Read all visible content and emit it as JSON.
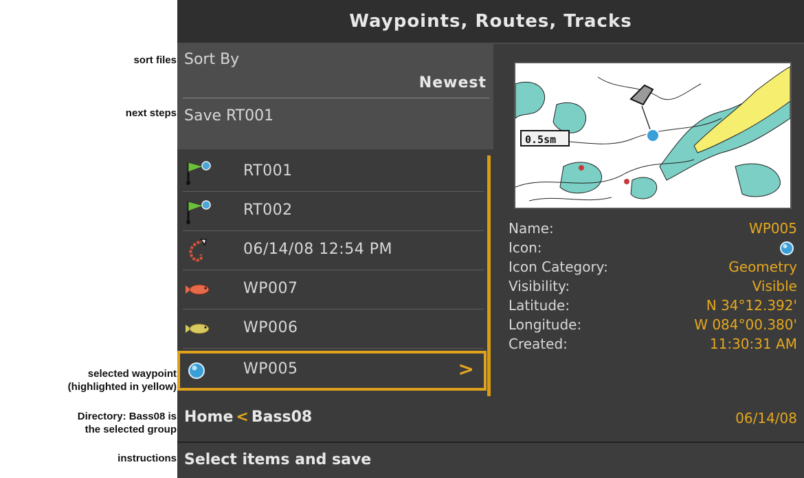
{
  "callouts": {
    "sort_files": "sort files",
    "next_steps": "next steps",
    "selected_waypoint_1": "selected waypoint",
    "selected_waypoint_2": "(highlighted in yellow)",
    "directory_1": "Directory: Bass08 is",
    "directory_2": "the selected group",
    "instructions": "instructions"
  },
  "screen": {
    "title": "Waypoints, Routes, Tracks",
    "sort": {
      "label": "Sort By",
      "value": "Newest"
    },
    "save_label": "Save RT001",
    "list": [
      {
        "icon": "route-flag-icon",
        "label": "RT001"
      },
      {
        "icon": "route-flag-icon",
        "label": "RT002"
      },
      {
        "icon": "track-icon",
        "label": "06/14/08 12:54 PM"
      },
      {
        "icon": "red-fish-icon",
        "label": "WP007"
      },
      {
        "icon": "yellow-fish-icon",
        "label": "WP006"
      },
      {
        "icon": "blue-ball-icon",
        "label": "WP005",
        "selected": true
      }
    ],
    "selected_arrow": ">",
    "breadcrumb": {
      "home": "Home",
      "separator": "<",
      "group": "Bass08"
    },
    "instructions": "Select items and save",
    "map": {
      "scale": "0.5sm"
    },
    "details": {
      "name_label": "Name:",
      "name_value": "WP005",
      "icon_label": "Icon:",
      "icon_value": "blue-ball-icon",
      "category_label": "Icon Category:",
      "category_value": "Geometry",
      "visibility_label": "Visibility:",
      "visibility_value": "Visible",
      "latitude_label": "Latitude:",
      "latitude_value": "N 34°12.392'",
      "longitude_label": "Longitude:",
      "longitude_value": "W 084°00.380'",
      "created_label": "Created:",
      "created_time": "11:30:31 AM",
      "created_date": "06/14/08"
    },
    "colors": {
      "accent": "#e6a81e",
      "background": "#3b3b3b",
      "panel": "#4d4d4d"
    }
  }
}
